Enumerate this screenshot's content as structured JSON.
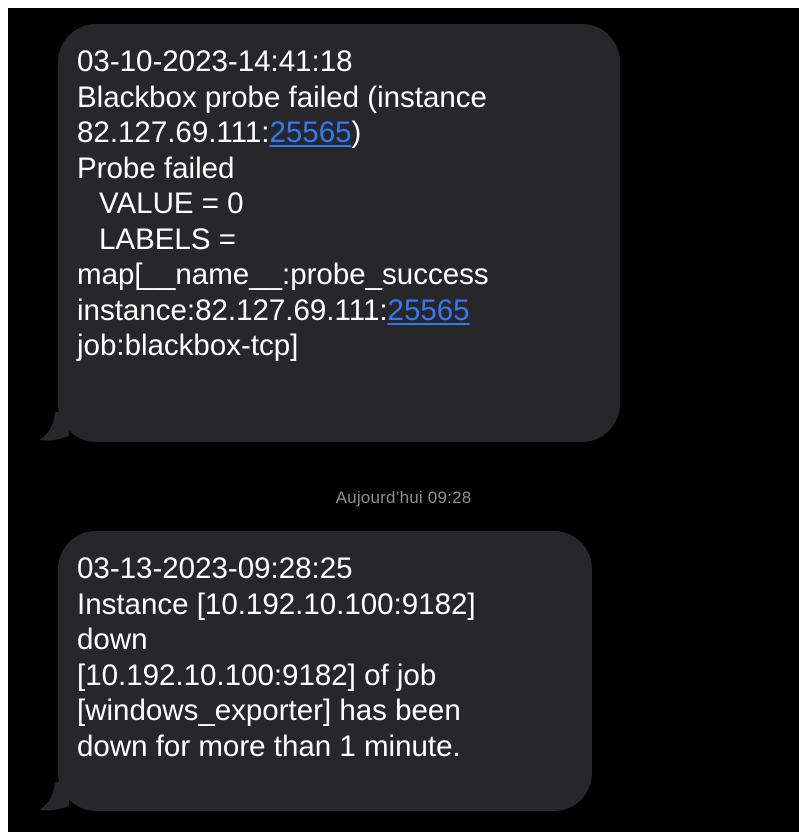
{
  "messages": [
    {
      "lines": [
        {
          "text": "03-10-2023-14:41:18"
        },
        {
          "text": "Blackbox probe failed (instance"
        },
        {
          "text": "82.127.69.111:",
          "link": "25565",
          "suffix": ")"
        },
        {
          "text": "Probe failed"
        },
        {
          "text": "VALUE = 0"
        },
        {
          "text": "LABELS ="
        },
        {
          "text": "map[__name__:probe_success"
        },
        {
          "text": "instance:82.127.69.111:",
          "link": "25565"
        },
        {
          "text": "job:blackbox-tcp]"
        }
      ]
    },
    {
      "lines": [
        {
          "text": "03-13-2023-09:28:25"
        },
        {
          "text": "Instance [10.192.10.100:9182]"
        },
        {
          "text": "down"
        },
        {
          "text": "[10.192.10.100:9182] of job"
        },
        {
          "text": "[windows_exporter] has been"
        },
        {
          "text": "down for more than 1 minute."
        }
      ]
    }
  ],
  "timestamp_divider": "Aujourd’hui 09:28",
  "colors": {
    "background": "#000000",
    "bubble": "#27272a",
    "text": "#ffffff",
    "link": "#3478f6",
    "timestamp": "#8e8e93"
  }
}
